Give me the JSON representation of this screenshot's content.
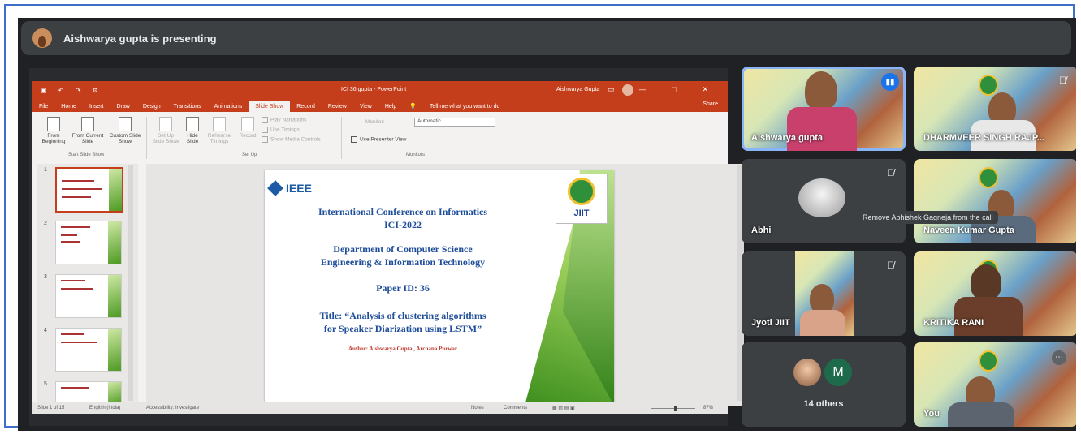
{
  "banner": {
    "presenting_text": "Aishwarya gupta is presenting"
  },
  "ppt": {
    "title": "ICI 36 gupta - PowerPoint",
    "user": "Aishwarya Gupta",
    "tabs": [
      "File",
      "Home",
      "Insert",
      "Draw",
      "Design",
      "Transitions",
      "Animations",
      "Slide Show",
      "Record",
      "Review",
      "View",
      "Help"
    ],
    "active_tab": "Slide Show",
    "tell_me": "Tell me what you want to do",
    "share": "Share",
    "ribbon": {
      "from_beginning": "From Beginning",
      "from_current": "From Current Slide",
      "custom_show": "Custom Slide Show",
      "group_start": "Start Slide Show",
      "set_up": "Set Up Slide Show",
      "hide_slide": "Hide Slide",
      "rehearse": "Rehearse Timings",
      "record": "Record",
      "play_narrations": "Play Narrations",
      "use_timings": "Use Timings",
      "show_media": "Show Media Controls",
      "group_setup": "Set Up",
      "monitor_label": "Monitor:",
      "monitor_value": "Automatic",
      "presenter_view": "Use Presenter View",
      "group_monitors": "Monitors"
    },
    "thumb_numbers": [
      "1",
      "2",
      "3",
      "4",
      "5"
    ],
    "slide": {
      "ieee": "IEEE",
      "seal_text": "JIIT",
      "line1": "International Conference on Informatics",
      "line2": "ICI-2022",
      "line3": "Department of Computer Science",
      "line4": "Engineering & Information Technology",
      "line5": "Paper ID: 36",
      "line6": "Title: “Analysis of clustering algorithms",
      "line7": "for Speaker Diarization using LSTM”",
      "line8": "Author: Aishwarya Gupta , Archana Purwar"
    },
    "status": {
      "slide_of": "Slide 1 of 15",
      "language": "English (India)",
      "accessibility": "Accessibility: Investigate",
      "notes": "Notes",
      "comments": "Comments",
      "zoom": "87%"
    }
  },
  "participants": [
    {
      "name": "Aishwarya gupta"
    },
    {
      "name": "DHARMVEER SINGH RAJP..."
    },
    {
      "name": "Abhi"
    },
    {
      "name": "Naveen Kumar Gupta"
    },
    {
      "name": "Jyoti JIIT"
    },
    {
      "name": "KRITIKA RANI"
    },
    {
      "name": "14 others",
      "avatar_letter": "M"
    },
    {
      "name": "You"
    }
  ],
  "tooltip": "Remove Abhishek Gagneja from the call",
  "colors": {
    "accent": "#c43e1c",
    "meet_bg": "#202124",
    "frame": "#3f6fc8",
    "speaker": "#1a73e8"
  }
}
